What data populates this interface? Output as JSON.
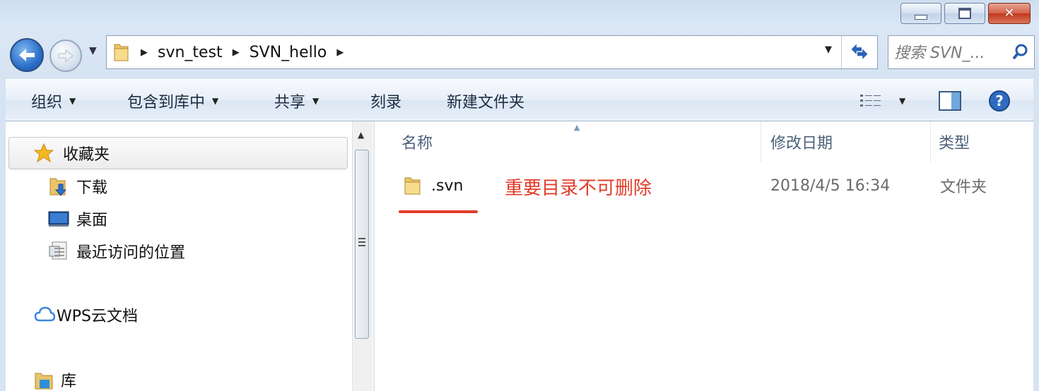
{
  "window": {
    "minimize_label": "▁",
    "maximize_label": "▢",
    "close_label": "✕"
  },
  "nav": {
    "breadcrumbs": [
      "svn_test",
      "SVN_hello"
    ],
    "search_placeholder": "搜索 SVN_..."
  },
  "toolbar": {
    "organize": "组织",
    "include_library": "包含到库中",
    "share": "共享",
    "burn": "刻录",
    "new_folder": "新建文件夹"
  },
  "sidebar": {
    "favorites": "收藏夹",
    "items": [
      "下载",
      "桌面",
      "最近访问的位置"
    ],
    "wps_cloud": "WPS云文档",
    "library": "库"
  },
  "columns": {
    "name": "名称",
    "date_modified": "修改日期",
    "type": "类型"
  },
  "files": [
    {
      "name": ".svn",
      "date_modified": "2018/4/5 16:34",
      "type": "文件夹"
    }
  ],
  "annotation": {
    "text": "重要目录不可删除",
    "color": "#e23c2a"
  },
  "icons": [
    "back-arrow-icon",
    "forward-arrow-icon",
    "folder-icon",
    "refresh-icon",
    "search-icon",
    "view-options-icon",
    "preview-pane-icon",
    "help-icon",
    "star-icon",
    "download-folder-icon",
    "desktop-icon",
    "recent-places-icon",
    "cloud-icon",
    "library-icon"
  ]
}
